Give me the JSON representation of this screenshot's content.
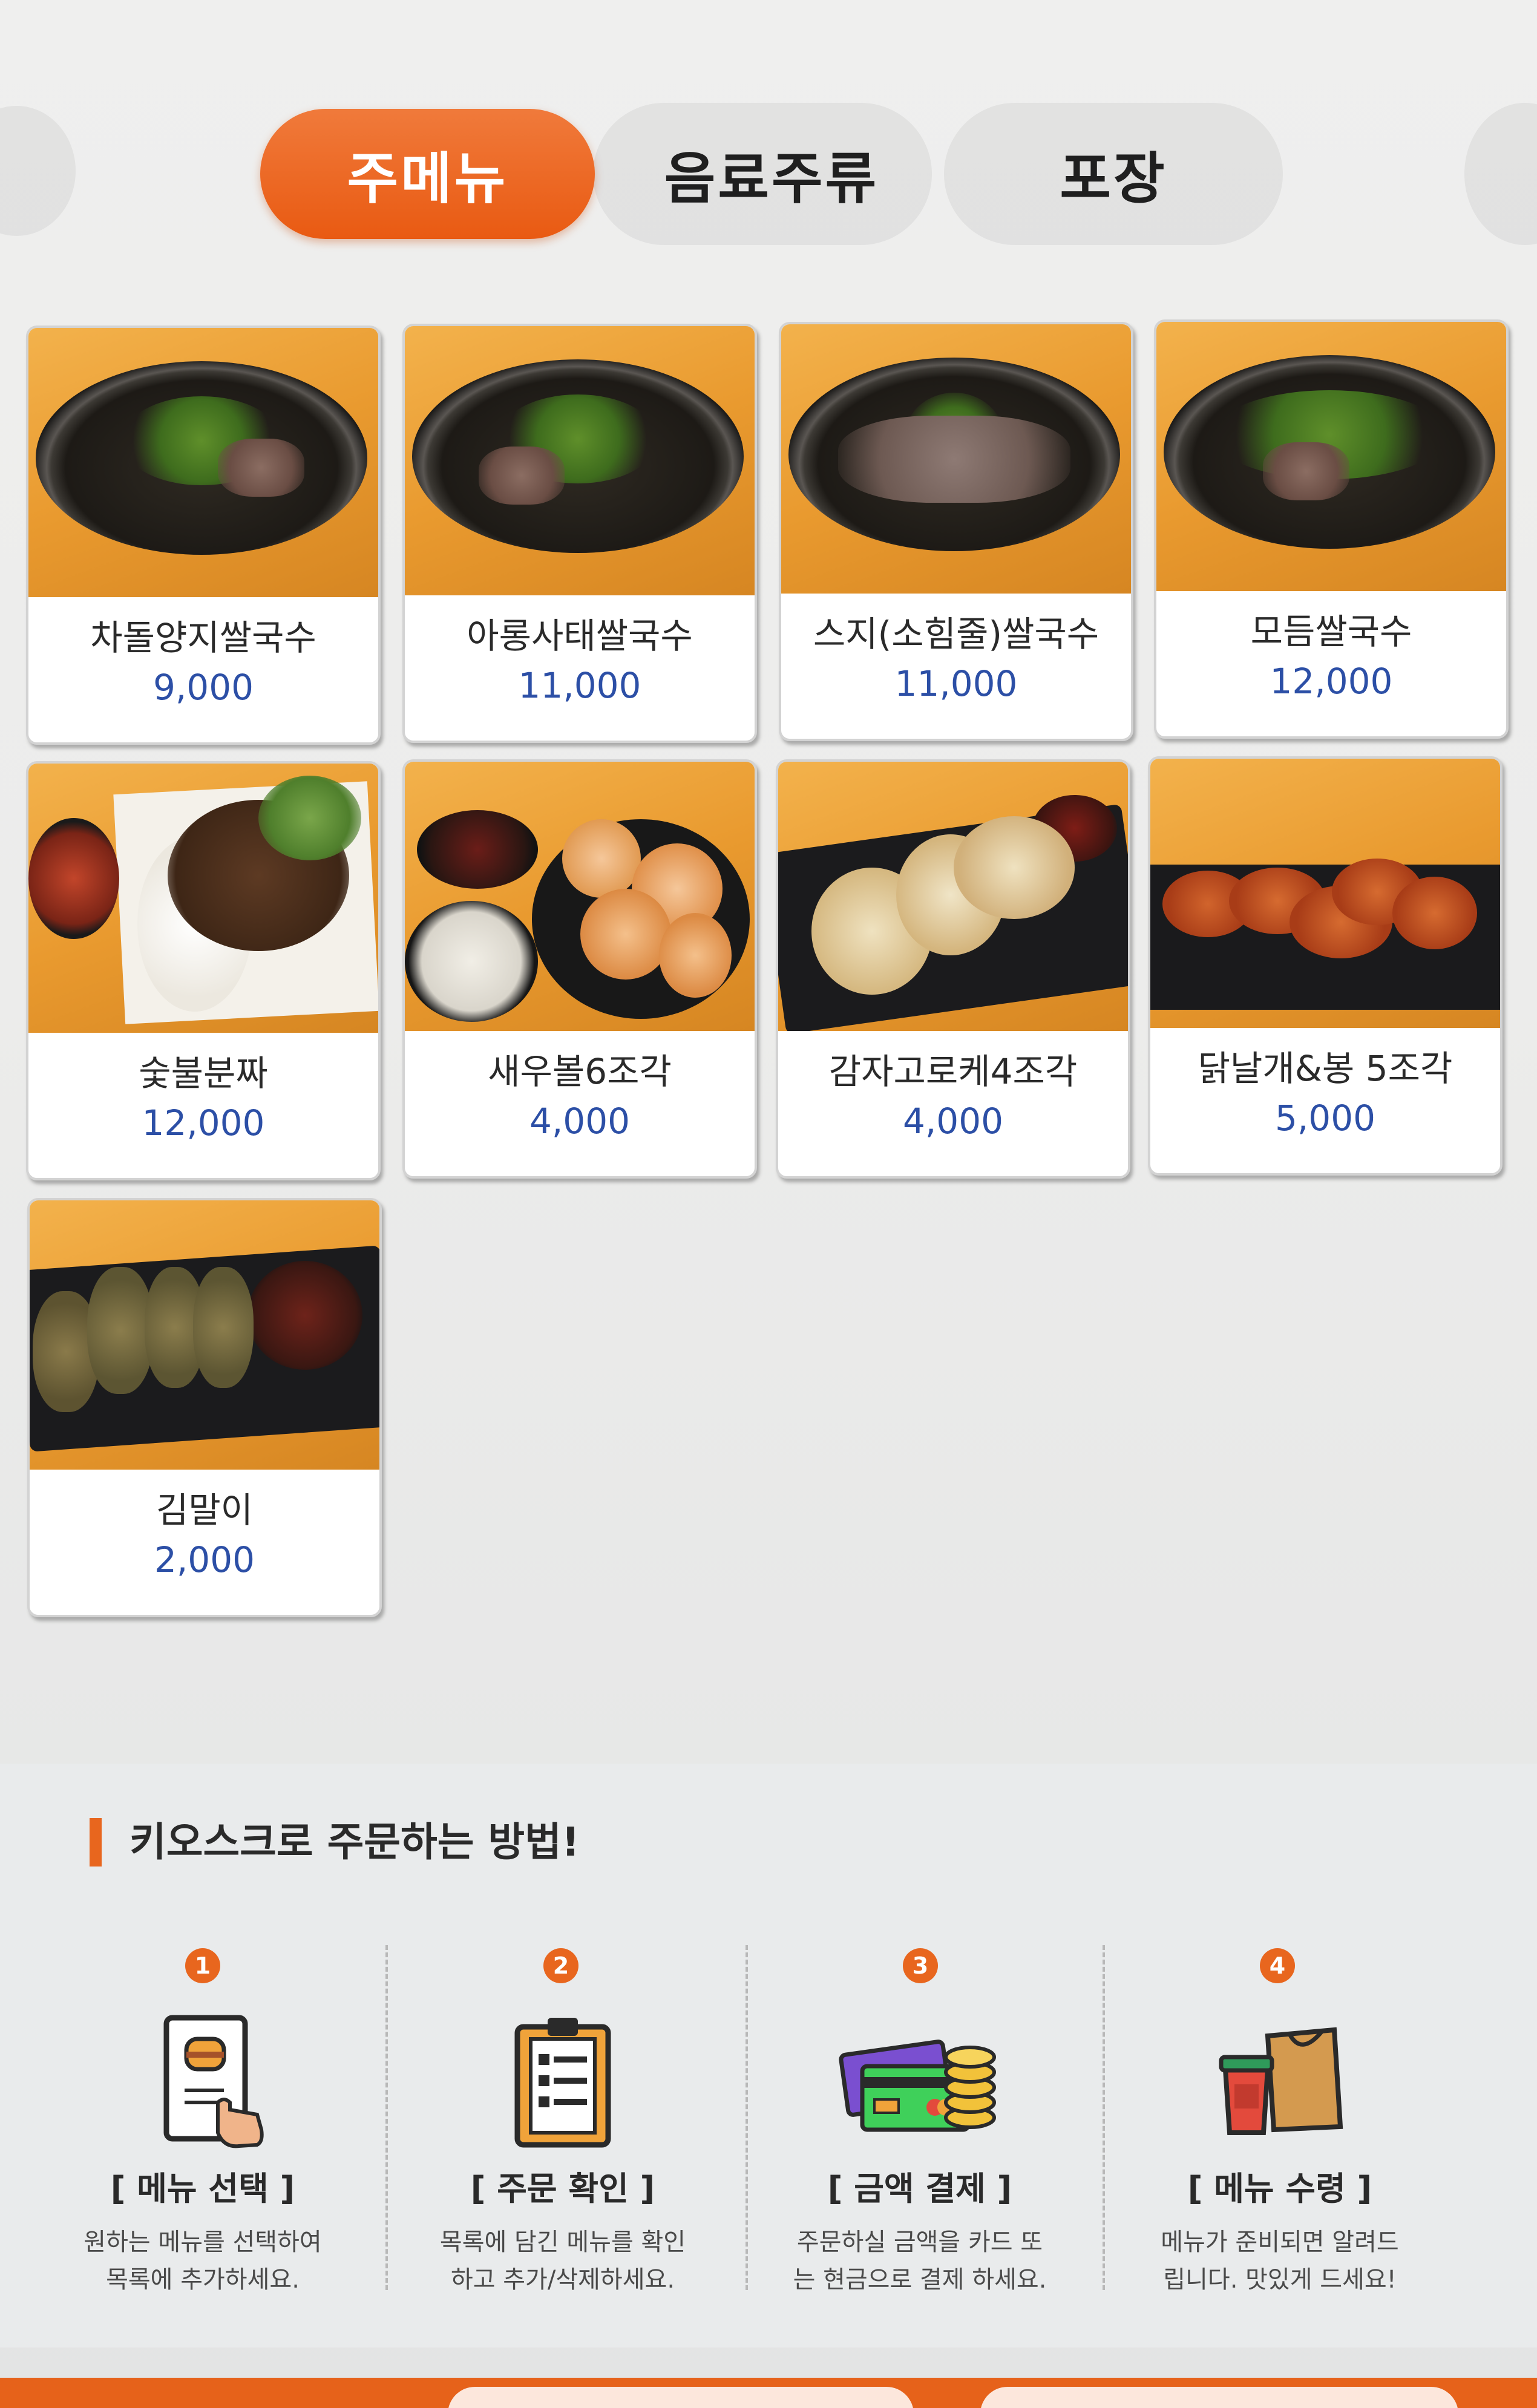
{
  "tabs": [
    {
      "label": "주메뉴",
      "active": true
    },
    {
      "label": "음료주류",
      "active": false
    },
    {
      "label": "포장",
      "active": false
    }
  ],
  "menu_items": [
    {
      "name": "차돌양지쌀국수",
      "price": "9,000"
    },
    {
      "name": "아롱사태쌀국수",
      "price": "11,000"
    },
    {
      "name": "스지(소힘줄)쌀국수",
      "price": "11,000"
    },
    {
      "name": "모듬쌀국수",
      "price": "12,000"
    },
    {
      "name": "숯불분짜",
      "price": "12,000"
    },
    {
      "name": "새우볼6조각",
      "price": "4,000"
    },
    {
      "name": "감자고로케4조각",
      "price": "4,000"
    },
    {
      "name": "닭날개&봉 5조각",
      "price": "5,000"
    },
    {
      "name": "김말이",
      "price": "2,000"
    }
  ],
  "howto": {
    "title": "키오스크로 주문하는 방법!",
    "steps": [
      {
        "number": "1",
        "icon": "tablet-touch-icon",
        "label": "[ 메뉴 선택 ]",
        "desc": "원하는 메뉴를 선택하여\n목록에 추가하세요."
      },
      {
        "number": "2",
        "icon": "clipboard-icon",
        "label": "[ 주문 확인 ]",
        "desc": "목록에 담긴 메뉴를 확인\n하고 추가/삭제하세요."
      },
      {
        "number": "3",
        "icon": "card-coins-icon",
        "label": "[ 금액 결제 ]",
        "desc": "주문하실 금액을 카드 또\n는 현금으로 결제 하세요."
      },
      {
        "number": "4",
        "icon": "takeout-bag-icon",
        "label": "[ 메뉴 수령 ]",
        "desc": "메뉴가 준비되면 알려드\n립니다. 맛있게 드세요!"
      }
    ]
  },
  "colors": {
    "accent": "#e8661e",
    "price": "#2c4fa6"
  }
}
